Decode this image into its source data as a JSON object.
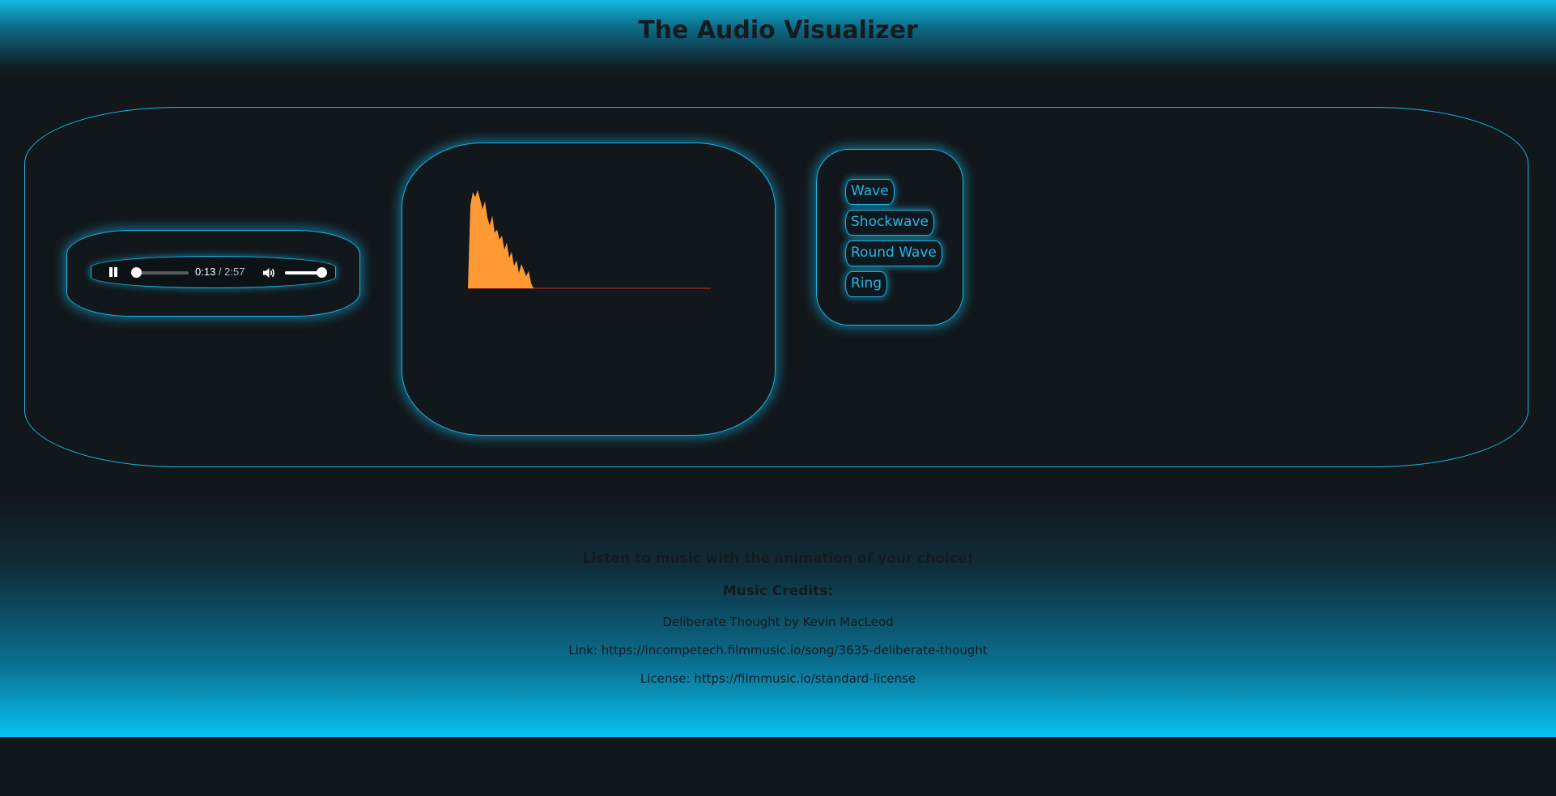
{
  "header": {
    "title": "The Audio Visualizer"
  },
  "player": {
    "current_time": "0:13",
    "separator": " / ",
    "duration": "2:57",
    "progress": 0.07,
    "volume": 1.0
  },
  "visualizer": {
    "fill_color": "#ff9933",
    "baseline_color": "#c0302a",
    "spectrum": [
      0.0,
      0.82,
      0.95,
      0.9,
      0.97,
      0.88,
      0.78,
      0.86,
      0.7,
      0.62,
      0.72,
      0.55,
      0.58,
      0.48,
      0.52,
      0.38,
      0.45,
      0.3,
      0.36,
      0.22,
      0.28,
      0.15,
      0.24,
      0.18,
      0.12,
      0.17,
      0.05,
      0.0,
      0.0,
      0.0,
      0.0,
      0.0
    ]
  },
  "modes": [
    {
      "label": "Wave"
    },
    {
      "label": "Shockwave"
    },
    {
      "label": "Round Wave"
    },
    {
      "label": "Ring"
    }
  ],
  "footer": {
    "tagline": "Listen to music with the animation of your choice!",
    "credits_heading": "Music Credits:",
    "song": "Deliberate Thought by Kevin MacLeod",
    "link": "Link: https://incompetech.filmmusic.io/song/3635-deliberate-thought",
    "license": "License: https://filmmusic.io/standard-license"
  },
  "colors": {
    "accent": "#17b5e5",
    "background": "#12171b",
    "text_dark": "#141b20"
  }
}
